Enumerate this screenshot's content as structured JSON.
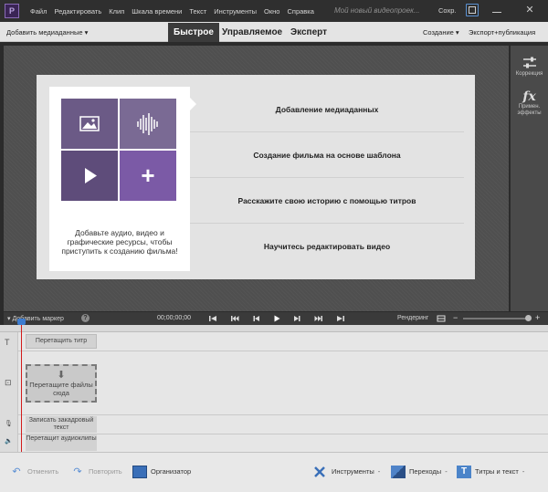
{
  "menu": {
    "items": [
      "Файл",
      "Редактировать",
      "Клип",
      "Шкала времени",
      "Текст",
      "Инструменты",
      "Окно",
      "Справка"
    ],
    "project_title": "Мой новый видеопроек...",
    "save_label": "Сохр.",
    "close_glyph": "✕"
  },
  "modebar": {
    "add_media": "Добавить медиаданные ▾",
    "tabs": [
      "Быстрое",
      "Управляемое",
      "Эксперт"
    ],
    "create": "Создание ▾",
    "export": "Экспорт+публикация"
  },
  "side_panel": {
    "adjust_label": "Коррекция",
    "fx_glyph": "fx",
    "fx_label": "Примен. эффекты"
  },
  "welcome": {
    "plus_glyph": "+",
    "caption": "Добавьте аудио, видео и графические ресурсы, чтобы приступить к созданию фильма!",
    "actions": [
      "Добавление медиаданных",
      "Создание фильма на основе шаблона",
      "Расскажите свою историю с помощью титров",
      "Научитесь редактировать видео"
    ]
  },
  "timeline": {
    "add_marker": "▾ Добавить маркер",
    "help": "?",
    "timecode": "00;00;00;00",
    "render": "Рендеринг",
    "zoom_minus": "−",
    "zoom_plus": "+",
    "drop_title": "Перетащить титр",
    "drop_media": "Перетащите файлы сюда",
    "drop_arrow": "⬇",
    "narration": "Записать закадровый текст",
    "audio_clips": "Перетащит аудиоклипы",
    "track_icons": [
      "T",
      "⊡",
      "🎙",
      "🔈"
    ]
  },
  "actionbar": {
    "undo": "Отменить",
    "redo": "Повторить",
    "organizer": "Организатор",
    "tools": "Инструменты",
    "transitions": "Переходы",
    "titles": "Титры и текст",
    "dash": "-"
  },
  "colors": {
    "accent_purple": "#7b5aa6",
    "playhead_red": "#d21c1c",
    "playhead_blue": "#3c7cd0",
    "active_tab": "#3b3b3b"
  }
}
